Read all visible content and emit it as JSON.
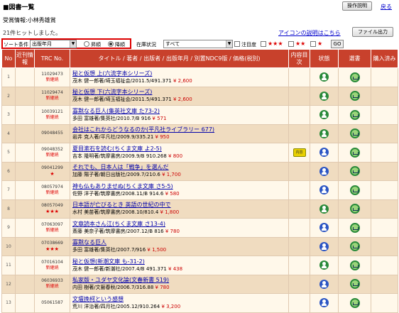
{
  "header": {
    "title": "■図書一覧",
    "help_button": "操作説明",
    "back_link": "戻る",
    "subtitle": "受賞情報:小林秀雄賞",
    "hits": "21件ヒットしました。",
    "icon_help_link": "アイコンの説明はこちら",
    "file_button": "ファイル出力"
  },
  "filters": {
    "sort_label": "ソート条件",
    "sort_value": "出版年月",
    "asc_label": "昇順",
    "desc_label": "降順",
    "stock_label": "在庫状況",
    "stock_value": "すべて",
    "attention_label": "注目度",
    "go_button": "GO"
  },
  "columns": [
    "No",
    "近刊情報",
    "TRC No.",
    "タイトル / 著者 / 出版者 / 出版年月 / 別置NDC9版 / 価格(税別)",
    "内容目次",
    "状態",
    "選書",
    "購入済み"
  ],
  "rows": [
    {
      "no": "1",
      "trc": "11029473",
      "tag": "新継続",
      "stars": "",
      "title": "秘と仮想 上(六流字本シリーズ)",
      "meta": "茂木 健一郎著/埼玉福祉会/2011.5/491.371",
      "price": "¥ 2,600",
      "naiyo": false,
      "status": "green"
    },
    {
      "no": "2",
      "trc": "11029474",
      "tag": "新継続",
      "stars": "",
      "title": "秘と仮想 下(六流字本シリーズ)",
      "meta": "茂木 健一郎著/埼玉福祉会/2011.5/491.371",
      "price": "¥ 2,600",
      "naiyo": false,
      "status": "green"
    },
    {
      "no": "3",
      "trc": "10039121",
      "tag": "新継続",
      "stars": "",
      "title": "寡黙なる巨人(集英社文庫 た73-2)",
      "meta": "多田 富雄著/集英社/2010.7/B 916",
      "price": "¥ 571",
      "naiyo": false,
      "status": "green"
    },
    {
      "no": "4",
      "trc": "09048455",
      "tag": "",
      "stars": "",
      "title": "会社はこれからどうなるのか(平凡社ライブラリー 677)",
      "meta": "岩井 克人著/平凡社/2009.9/335.21",
      "price": "¥ 950",
      "naiyo": false,
      "status": "green"
    },
    {
      "no": "5",
      "trc": "09048352",
      "tag": "新継続",
      "stars": "",
      "title": "夏目漱石を読む(ちくま文庫 よ2-5)",
      "meta": "吉本 隆明著/筑摩書房/2009.9/B 910.268",
      "price": "¥ 800",
      "naiyo": true,
      "status": "blue"
    },
    {
      "no": "6",
      "trc": "09041299",
      "tag": "",
      "stars": "★",
      "title": "それでも、日本人は「戦争」を選んだ",
      "meta": "加藤 陽子著/朝日出版社/2009.7/210.6",
      "price": "¥ 1,700",
      "naiyo": false,
      "status": "blue"
    },
    {
      "no": "7",
      "trc": "08057974",
      "tag": "新継続",
      "stars": "",
      "title": "神も仏もありませぬ(ちくま文庫 さ5-5)",
      "meta": "佐野 洋子著/筑摩書房/2008.11/B 914.6",
      "price": "¥ 580",
      "naiyo": false,
      "status": "blue"
    },
    {
      "no": "8",
      "trc": "08057049",
      "tag": "",
      "stars": "★★★",
      "title": "日本語が亡びるとき 英語の世紀の中で",
      "meta": "水村 美苗著/筑摩書房/2008.10/810.4",
      "price": "¥ 1,800",
      "naiyo": false,
      "status": "green"
    },
    {
      "no": "9",
      "trc": "07063097",
      "tag": "新継続",
      "stars": "",
      "title": "文章読本さん江(ちくま文庫 さ13-4)",
      "meta": "斎藤 美奈子著/筑摩書房/2007.12/B 816",
      "price": "¥ 780",
      "naiyo": false,
      "status": "blue"
    },
    {
      "no": "10",
      "trc": "07038669",
      "tag": "",
      "stars": "★★★",
      "title": "寡黙なる巨人",
      "meta": "多田 富雄著/集英社/2007.7/916",
      "price": "¥ 1,500",
      "naiyo": false,
      "status": "blue"
    },
    {
      "no": "11",
      "trc": "07016104",
      "tag": "新継続",
      "stars": "",
      "title": "秘と仮想(新潮文庫 も-31-2)",
      "meta": "茂木 健一郎著/新潮社/2007.4/B 491.371",
      "price": "¥ 438",
      "naiyo": false,
      "status": "green"
    },
    {
      "no": "12",
      "trc": "06036933",
      "tag": "新継続",
      "stars": "",
      "title": "私家版・ユダヤ文化論(文春新書 519)",
      "meta": "内田 樹著/文藝春秋/2006.7/316.88",
      "price": "¥ 780",
      "naiyo": false,
      "status": "blue"
    },
    {
      "no": "13",
      "trc": "05061587",
      "tag": "",
      "stars": "",
      "title": "文壇挽柯という感想",
      "meta": "荒川 洋治著/四月社/2005.12/910.264",
      "price": "¥ 3,200",
      "naiyo": false,
      "status": "blue"
    }
  ]
}
